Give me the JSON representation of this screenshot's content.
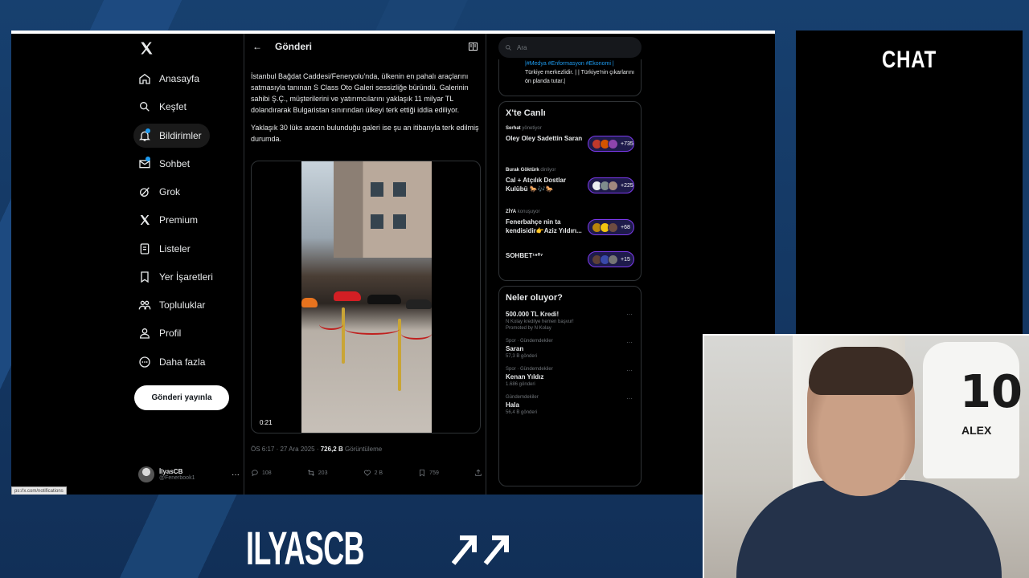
{
  "nav": {
    "items": [
      {
        "label": "Anasayfa",
        "icon": "home-icon"
      },
      {
        "label": "Keşfet",
        "icon": "search-icon"
      },
      {
        "label": "Bildirimler",
        "icon": "bell-icon"
      },
      {
        "label": "Sohbet",
        "icon": "mail-icon"
      },
      {
        "label": "Grok",
        "icon": "grok-icon"
      },
      {
        "label": "Premium",
        "icon": "x-icon"
      },
      {
        "label": "Listeler",
        "icon": "list-icon"
      },
      {
        "label": "Yer İşaretleri",
        "icon": "bookmark-icon"
      },
      {
        "label": "Topluluklar",
        "icon": "people-icon"
      },
      {
        "label": "Profil",
        "icon": "person-icon"
      },
      {
        "label": "Daha fazla",
        "icon": "more-icon"
      }
    ],
    "post_button": "Gönderi yayınla",
    "profile_name": "İlyasCB",
    "profile_handle": "@Fenerbook1",
    "status_url": "ps://x.com/notifications"
  },
  "main": {
    "header_title": "Gönderi",
    "tweet_p1": "İstanbul Bağdat Caddesi/Feneryolu'nda, ülkenin en pahalı araçlarını satmasıyla tanınan S Class Oto Galeri sessizliğe büründü. Galerinin sahibi Ş.Ç., müşterilerini ve yatırımcılarını yaklaşık 11 milyar TL dolandırarak Bulgaristan sınırından ülkeyi terk ettiği iddia ediliyor.",
    "tweet_p2": "Yaklaşık 30 lüks aracın bulunduğu galeri ise şu an itibarıyla terk edilmiş durumda.",
    "video_time": "0:21",
    "meta_time": "ÖS 6:17 · 27 Ara 2025 · ",
    "meta_views": "726,2 B",
    "meta_views_label": " Görüntüleme",
    "actions": {
      "replies": "108",
      "reposts": "203",
      "likes": "2 B",
      "bookmarks": "759"
    }
  },
  "right": {
    "search_placeholder": "Ara",
    "top_card_tags": "|#Medya #Enformasyon #Ekonomi |",
    "top_card_text": "Türkiye merkezlidir. | | Türkiye'nin çıkarlarını ön planda tutar.|",
    "live_title": "X'te Canlı",
    "live": [
      {
        "host": "Serhat",
        "status": "yönetiyor",
        "title": "Oley Oley Sadettin Saran",
        "count": "+735"
      },
      {
        "host": "Burak Göktürk",
        "status": "dinliyor",
        "title": "Cal + Atçılık Dostlar Kulübü 🐎🎶🐎",
        "count": "+225"
      },
      {
        "host": "ZİYA",
        "status": "konuşuyor",
        "title": "Fenerbahçe nin ta kendisidir👉Aziz Yıldırı...",
        "count": "+68"
      },
      {
        "host": "",
        "status": "",
        "title": "SOHBET¹⁹⁰⁷",
        "count": "+15"
      }
    ],
    "trends_title": "Neler oluyor?",
    "trends": [
      {
        "cat": "",
        "name": "500.000 TL Kredi!",
        "sub": "N Kolay kredilye hemen başvur!",
        "extra": "Promoted by N Kolay"
      },
      {
        "cat": "Spor · Gündemdekiler",
        "name": "Saran",
        "sub": "57,3 B gönderi",
        "extra": ""
      },
      {
        "cat": "Spor · Gündemdekiler",
        "name": "Kenan Yıldız",
        "sub": "1.686 gönderi",
        "extra": ""
      },
      {
        "cat": "Gündemdekiler",
        "name": "Hala",
        "sub": "56,4 B gönderi",
        "extra": ""
      }
    ]
  },
  "chat": {
    "title": "CHAT"
  },
  "webcam": {
    "jersey_number": "10",
    "jersey_name": "ALEX"
  },
  "branding": {
    "name": "ILYASCB"
  },
  "colors": {
    "accent": "#1d9bf0",
    "live_pill_border": "#7c3aed",
    "background": "#163a66"
  }
}
